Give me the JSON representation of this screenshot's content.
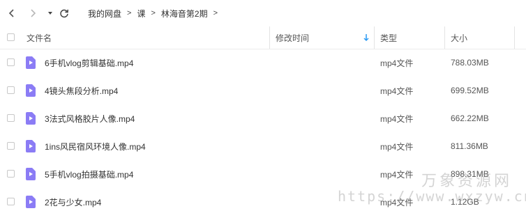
{
  "breadcrumb": [
    "我的网盘",
    "课",
    "林海音第2期"
  ],
  "breadcrumb_separator": ">",
  "columns": {
    "name": "文件名",
    "modified": "修改时间",
    "type": "类型",
    "size": "大小"
  },
  "files": [
    {
      "name": "6手机vlog剪辑基础.mp4",
      "type": "mp4文件",
      "size": "788.03MB"
    },
    {
      "name": "4镜头焦段分析.mp4",
      "type": "mp4文件",
      "size": "699.52MB"
    },
    {
      "name": "3法式风格胶片人像.mp4",
      "type": "mp4文件",
      "size": "662.22MB"
    },
    {
      "name": "1ins风民宿风环境人像.mp4",
      "type": "mp4文件",
      "size": "811.36MB"
    },
    {
      "name": "5手机vlog拍摄基础.mp4",
      "type": "mp4文件",
      "size": "898.31MB"
    },
    {
      "name": "2花与少女.mp4",
      "type": "mp4文件",
      "size": "1.12GB"
    }
  ],
  "watermark": {
    "text": "万象资源网",
    "url": "https://www.wxzyw.cn"
  },
  "colors": {
    "file_icon": "#8b7cf5",
    "sort_arrow": "#2a9af3"
  },
  "icons": {
    "back": "chevron-left-icon",
    "forward": "chevron-right-icon",
    "dropdown": "caret-down-icon",
    "refresh": "refresh-icon",
    "file": "video-file-icon",
    "sort": "sort-down-arrow-icon"
  }
}
